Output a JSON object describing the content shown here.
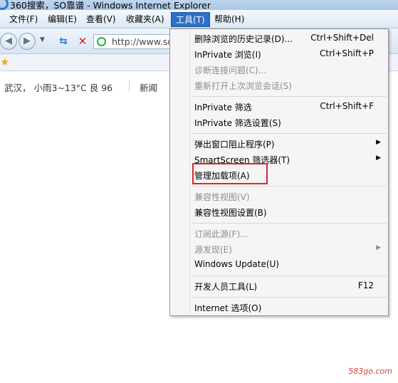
{
  "window": {
    "title": "360搜索，SO靠谱 - Windows Internet Explorer"
  },
  "menubar": {
    "items": [
      {
        "label": "文件(F)"
      },
      {
        "label": "编辑(E)"
      },
      {
        "label": "查看(V)"
      },
      {
        "label": "收藏夹(A)"
      },
      {
        "label": "工具(T)"
      },
      {
        "label": "帮助(H)"
      }
    ]
  },
  "navbar": {
    "back_icon": "back-arrow-icon",
    "forward_icon": "forward-arrow-icon",
    "address_value": "http://www.so"
  },
  "content": {
    "weather": "武汉， 小雨3~13°C  良 96",
    "news": "新闻",
    "watermark": "583go.com"
  },
  "tools_menu": {
    "items": [
      {
        "label": "删除浏览的历史记录(D)...",
        "shortcut": "Ctrl+Shift+Del"
      },
      {
        "label": "InPrivate 浏览(I)",
        "shortcut": "Ctrl+Shift+P"
      },
      {
        "label": "诊断连接问题(C)...",
        "shortcut": ""
      },
      {
        "label": "重新打开上次浏览会话(S)",
        "shortcut": ""
      },
      {
        "label": "InPrivate 筛选",
        "shortcut": "Ctrl+Shift+F"
      },
      {
        "label": "InPrivate 筛选设置(S)",
        "shortcut": ""
      },
      {
        "label": "弹出窗口阻止程序(P)",
        "shortcut": ""
      },
      {
        "label": "SmartScreen 筛选器(T)",
        "shortcut": ""
      },
      {
        "label": "管理加载项(A)",
        "shortcut": ""
      },
      {
        "label": "兼容性视图(V)",
        "shortcut": ""
      },
      {
        "label": "兼容性视图设置(B)",
        "shortcut": ""
      },
      {
        "label": "订阅此源(F)...",
        "shortcut": ""
      },
      {
        "label": "源发现(E)",
        "shortcut": ""
      },
      {
        "label": "Windows Update(U)",
        "shortcut": ""
      },
      {
        "label": "开发人员工具(L)",
        "shortcut": "F12"
      },
      {
        "label": "Internet 选项(O)",
        "shortcut": ""
      }
    ]
  },
  "colors": {
    "highlight_border": "#e0252a",
    "menu_active": "#2f6fc4"
  }
}
